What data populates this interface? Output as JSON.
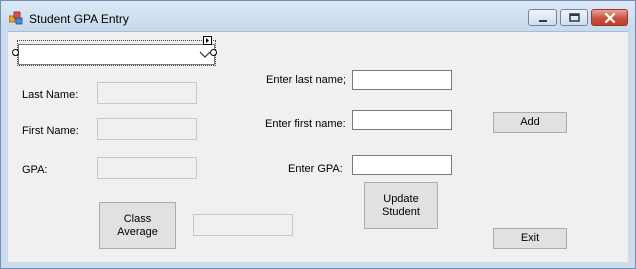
{
  "window": {
    "title": "Student GPA Entry",
    "app_icon": "windows-form-icon",
    "caption_buttons": [
      "minimize-icon",
      "maximize-icon",
      "close-icon"
    ]
  },
  "combo": {
    "selected": "",
    "arrow_icon": "chevron-down-icon"
  },
  "left_panel": {
    "last_name_label": "Last Name:",
    "first_name_label": "First Name:",
    "gpa_label": "GPA:",
    "last_name_value": "",
    "first_name_value": "",
    "gpa_value": ""
  },
  "entry": {
    "last_name_label": "Enter last name;",
    "first_name_label": "Enter first name:",
    "gpa_label": "Enter GPA:",
    "last_name_value": "",
    "first_name_value": "",
    "gpa_value": ""
  },
  "buttons": {
    "add": "Add",
    "update": "Update\nStudent",
    "class_average": "Class\nAverage",
    "exit": "Exit"
  },
  "class_average_value": "",
  "colors": {
    "frame": "#cddcec",
    "client": "#f0f0f0",
    "button": "#e1e1e1",
    "close_button": "#c7523e"
  }
}
